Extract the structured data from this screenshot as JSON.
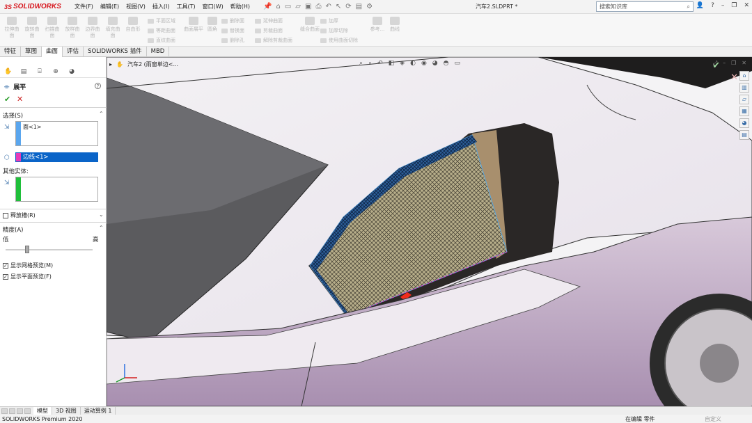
{
  "app": {
    "logo": "SOLIDWORKS",
    "logo_prefix": "3S",
    "doc_title": "汽车2.SLDPRT *"
  },
  "menu": [
    "文件(F)",
    "编辑(E)",
    "视图(V)",
    "插入(I)",
    "工具(T)",
    "窗口(W)",
    "帮助(H)"
  ],
  "search": {
    "placeholder": "搜索知识库"
  },
  "command_manager": {
    "big_buttons": [
      "拉伸曲面",
      "旋转曲面",
      "扫描曲面",
      "放样曲面",
      "边界曲面",
      "填充曲面",
      "自由形"
    ],
    "row_items": [
      "平面区域",
      "等距曲面",
      "直纹曲面",
      "曲面展平",
      "圆角",
      "删除面",
      "替换面",
      "删除孔",
      "延伸曲面",
      "剪裁曲面",
      "解除剪裁曲面",
      "缝合曲面",
      "加厚",
      "加厚切除",
      "使用曲面切除",
      "参考...",
      "曲线"
    ]
  },
  "tabs": [
    "特征",
    "草图",
    "曲面",
    "评估",
    "SOLIDWORKS 插件",
    "MBD"
  ],
  "active_tab": "曲面",
  "property_manager": {
    "title": "展平",
    "help": "?",
    "selection_label": "选择(S)",
    "face_value": "面<1>",
    "edge_value": "边线<1>",
    "other_bodies_label": "其他实体:",
    "relief_cut_label": "释放槽(R)",
    "precision_label": "精度(A)",
    "low_label": "低",
    "high_label": "高",
    "precision_level": 0.25,
    "show_mesh_label": "显示网格预览(M)",
    "show_flat_label": "显示平面预览(F)",
    "show_mesh_checked": true,
    "show_flat_checked": true,
    "relief_checked": false
  },
  "viewport": {
    "tree_crumb": "汽车2 (雨窗单边<..."
  },
  "bottom_tabs": [
    "模型",
    "3D 视图",
    "运动算例 1"
  ],
  "status": {
    "app_version": "SOLIDWORKS Premium 2020",
    "mode": "在编辑 零件",
    "custom": "自定义"
  }
}
